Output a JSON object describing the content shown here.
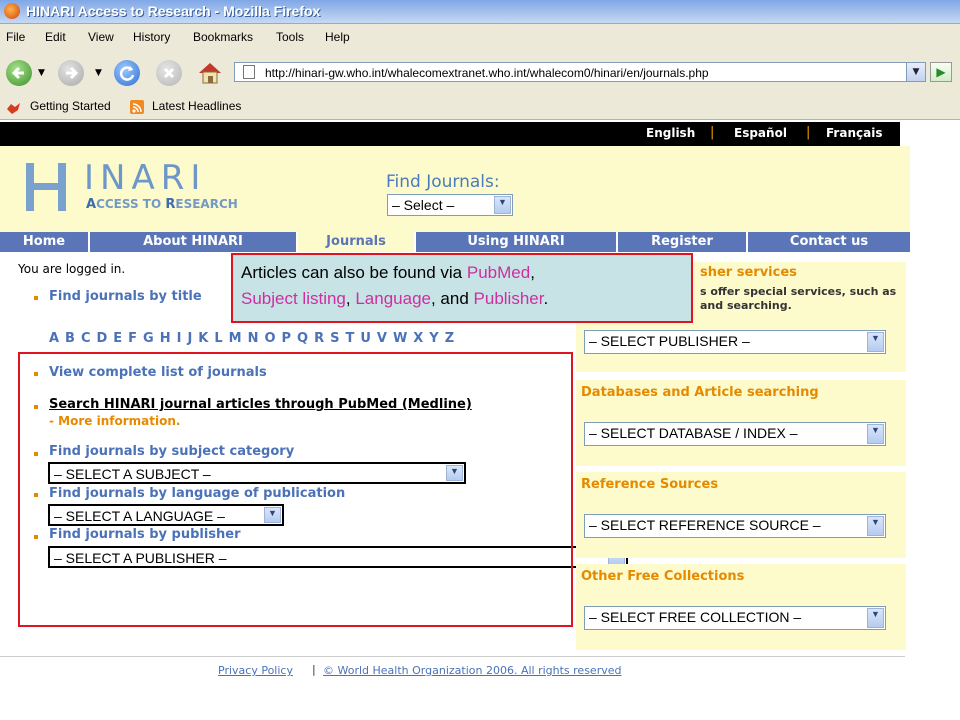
{
  "window": {
    "title": "HINARI Access to Research - Mozilla Firefox"
  },
  "menu": [
    "File",
    "Edit",
    "View",
    "History",
    "Bookmarks",
    "Tools",
    "Help"
  ],
  "address": {
    "url": "http://hinari-gw.who.int/whalecomextranet.who.int/whalecom0/hinari/en/journals.php"
  },
  "bookmarks": [
    "Getting Started",
    "Latest Headlines"
  ],
  "languages": [
    "English",
    "Español",
    "Français"
  ],
  "logo": {
    "letter": "H",
    "rest": "INARI",
    "sub_a": "A",
    "sub_a_rest": "CCESS TO ",
    "sub_r": "R",
    "sub_r_rest": "ESEARCH"
  },
  "find_journals": {
    "title": "Find Journals:",
    "select": "– Select –"
  },
  "nav": [
    "Home",
    "About HINARI",
    "Journals",
    "Using HINARI",
    "Register",
    "Contact us"
  ],
  "main": {
    "logged_in": "You are logged in.",
    "find_by_title": "Find journals by title",
    "alphabet": "ABCDEFGHIJKLMNOPQRSTUVWXYZ",
    "view_complete": "View complete list of journals",
    "search_pubmed": "Search HINARI journal articles through PubMed (Medline)",
    "more_info": "- More information.",
    "by_subject": "Find journals by subject category",
    "subject_select": "– SELECT A SUBJECT –",
    "by_language": "Find journals by language of publication",
    "language_select": "– SELECT A LANGUAGE –",
    "by_publisher": "Find journals by publisher",
    "publisher_select": "– SELECT A PUBLISHER –"
  },
  "right": {
    "publisher_head": "sher services",
    "publisher_desc_1": "s offer special services, such as",
    "publisher_desc_2": "and searching.",
    "publisher_select": "– SELECT PUBLISHER –",
    "databases_head": "Databases and Article searching",
    "databases_select": "– SELECT DATABASE / INDEX –",
    "reference_head": "Reference Sources",
    "reference_select": "– SELECT REFERENCE SOURCE –",
    "free_head": "Other Free Collections",
    "free_select": "– SELECT FREE COLLECTION –"
  },
  "callout": {
    "part1": "Articles can also be found via ",
    "pubmed": "PubMed",
    "part2": ",",
    "subject": "Subject listing",
    "part3": ", ",
    "language": "Language",
    "part4": ", and ",
    "publisher": "Publisher",
    "part5": "."
  },
  "footer": {
    "privacy": "Privacy Policy",
    "sep": "|",
    "copyright": "© World Health Organization 2006. All rights reserved"
  },
  "colors": {
    "nav_blue": "#5a76b9",
    "cream": "#fdfbcc",
    "orange": "#e58a00",
    "link_blue": "#4b72b8",
    "annotation_red": "#e0141e",
    "callout_bg": "#c8e3e6",
    "callout_pink": "#cc2fa0"
  }
}
